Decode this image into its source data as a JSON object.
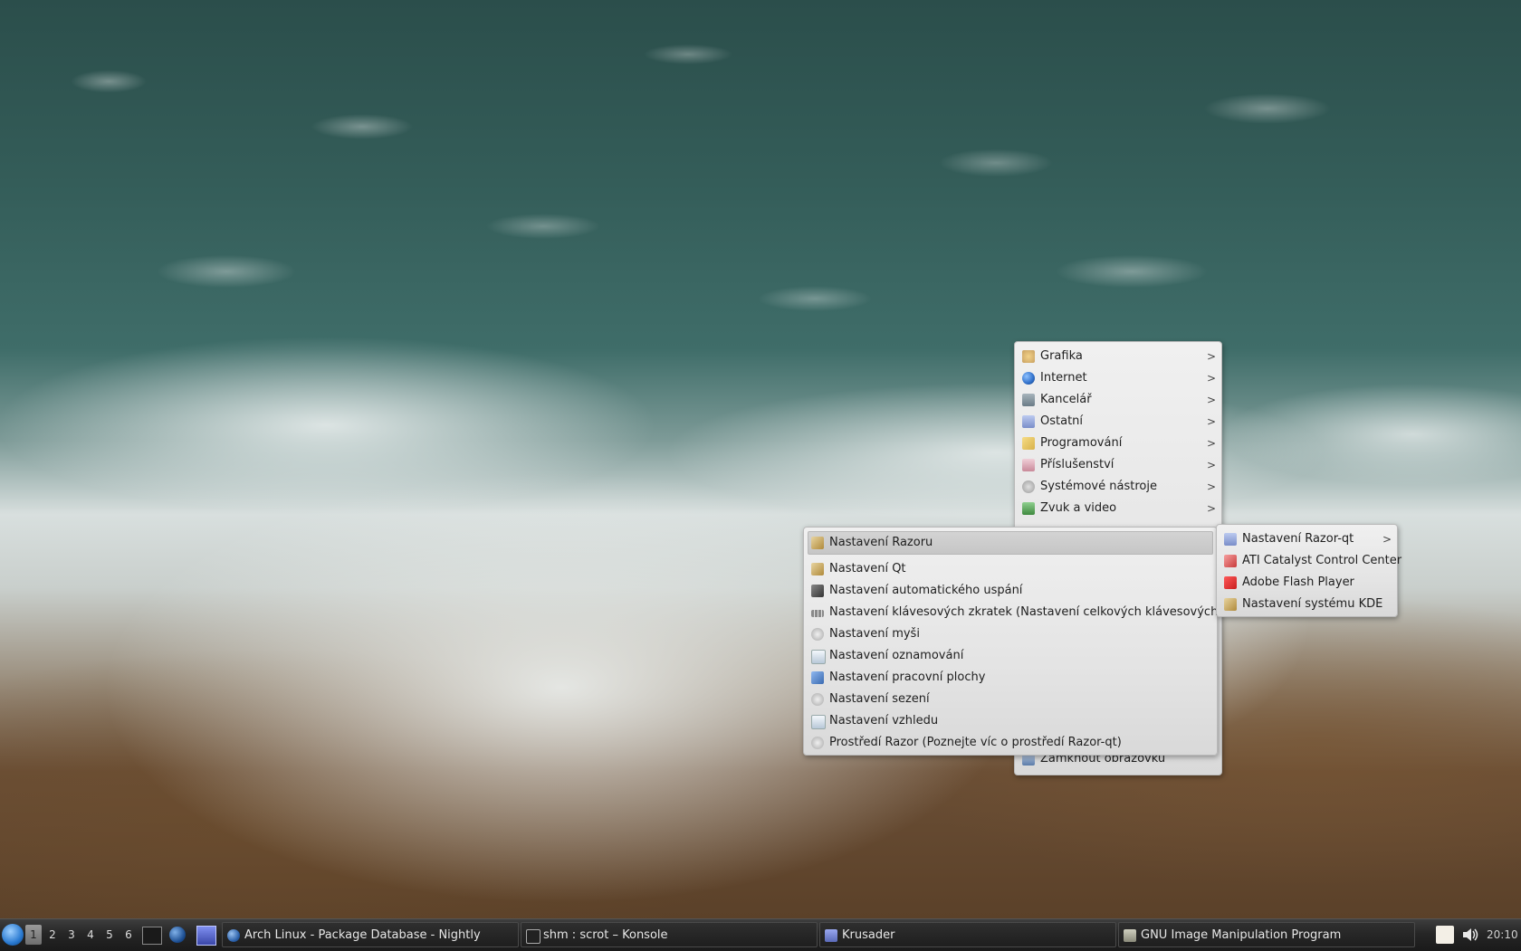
{
  "desktop": {
    "wallpaper": "ocean-waves-beach"
  },
  "main_menu": {
    "items": [
      {
        "label": "Grafika",
        "icon": "graphics-icon",
        "has_submenu": true,
        "color": "#c8a060"
      },
      {
        "label": "Internet",
        "icon": "globe-icon",
        "has_submenu": true,
        "color": "#2f6fc9"
      },
      {
        "label": "Kancelář",
        "icon": "office-icon",
        "has_submenu": true,
        "color": "#6a7b86"
      },
      {
        "label": "Ostatní",
        "icon": "other-icon",
        "has_submenu": true,
        "color": "#7a8ec9"
      },
      {
        "label": "Programování",
        "icon": "programming-icon",
        "has_submenu": true,
        "color": "#d8b24a"
      },
      {
        "label": "Příslušenství",
        "icon": "accessories-icon",
        "has_submenu": true,
        "color": "#c98a9a"
      },
      {
        "label": "Systémové nástroje",
        "icon": "system-tools-icon",
        "has_submenu": true,
        "color": "#9a9a9a"
      },
      {
        "label": "Zvuk a video",
        "icon": "multimedia-icon",
        "has_submenu": true,
        "color": "#3f8a3f"
      }
    ],
    "bottom_item": {
      "label": "Zamknout obrazovku",
      "icon": "lock-screen-icon",
      "color": "#5a7aa8"
    }
  },
  "settings_menu": {
    "items": [
      {
        "label": "Nastavení Razoru",
        "icon": "razor-settings-icon",
        "active": true,
        "color": "#b08a3a"
      },
      {
        "label": "Nastavení Qt",
        "icon": "qt-settings-icon",
        "color": "#b08a3a"
      },
      {
        "label": "Nastavení automatického uspání",
        "icon": "autosuspend-icon",
        "color": "#333333"
      },
      {
        "label": "Nastavení klávesových zkratek (Nastavení celkových klávesových zkratek)",
        "icon": "keyboard-shortcuts-icon",
        "color": "#8a8a8a"
      },
      {
        "label": "Nastavení myši",
        "icon": "mouse-settings-icon",
        "color": "#a8a8a8"
      },
      {
        "label": "Nastavení oznamování",
        "icon": "notification-settings-icon",
        "color": "#b8c8d8"
      },
      {
        "label": "Nastavení pracovní plochy",
        "icon": "desktop-settings-icon",
        "color": "#3a6ab0"
      },
      {
        "label": "Nastavení sezení",
        "icon": "session-settings-icon",
        "color": "#a8a8a8"
      },
      {
        "label": "Nastavení vzhledu",
        "icon": "appearance-settings-icon",
        "color": "#b8c8d8"
      },
      {
        "label": "Prostředí Razor (Poznejte víc o prostředí Razor-qt)",
        "icon": "about-razor-icon",
        "color": "#a8a8a8"
      }
    ]
  },
  "sub_menu": {
    "items": [
      {
        "label": "Nastavení Razor-qt",
        "icon": "razor-qt-icon",
        "has_submenu": true,
        "color": "#7a8ec9"
      },
      {
        "label": "ATI Catalyst Control Center",
        "icon": "ati-icon",
        "color": "#c83a3a"
      },
      {
        "label": "Adobe Flash Player",
        "icon": "flash-icon",
        "color": "#c81e1e"
      },
      {
        "label": "Nastavení systému KDE",
        "icon": "kde-settings-icon",
        "color": "#b08a3a"
      }
    ]
  },
  "taskbar": {
    "desktops": [
      "1",
      "2",
      "3",
      "4",
      "5",
      "6"
    ],
    "current_desktop": "1",
    "tasks": [
      {
        "label": "Arch Linux - Package Database - Nightly",
        "icon": "firefox-icon",
        "color": "#2a5fa8"
      },
      {
        "label": "shm : scrot – Konsole",
        "icon": "terminal-icon",
        "color": "#444444"
      },
      {
        "label": "Krusader",
        "icon": "krusader-icon",
        "color": "#5a6ab8"
      },
      {
        "label": "GNU Image Manipulation Program",
        "icon": "gimp-icon",
        "color": "#8a8a7a"
      }
    ],
    "clock": "20:10"
  }
}
